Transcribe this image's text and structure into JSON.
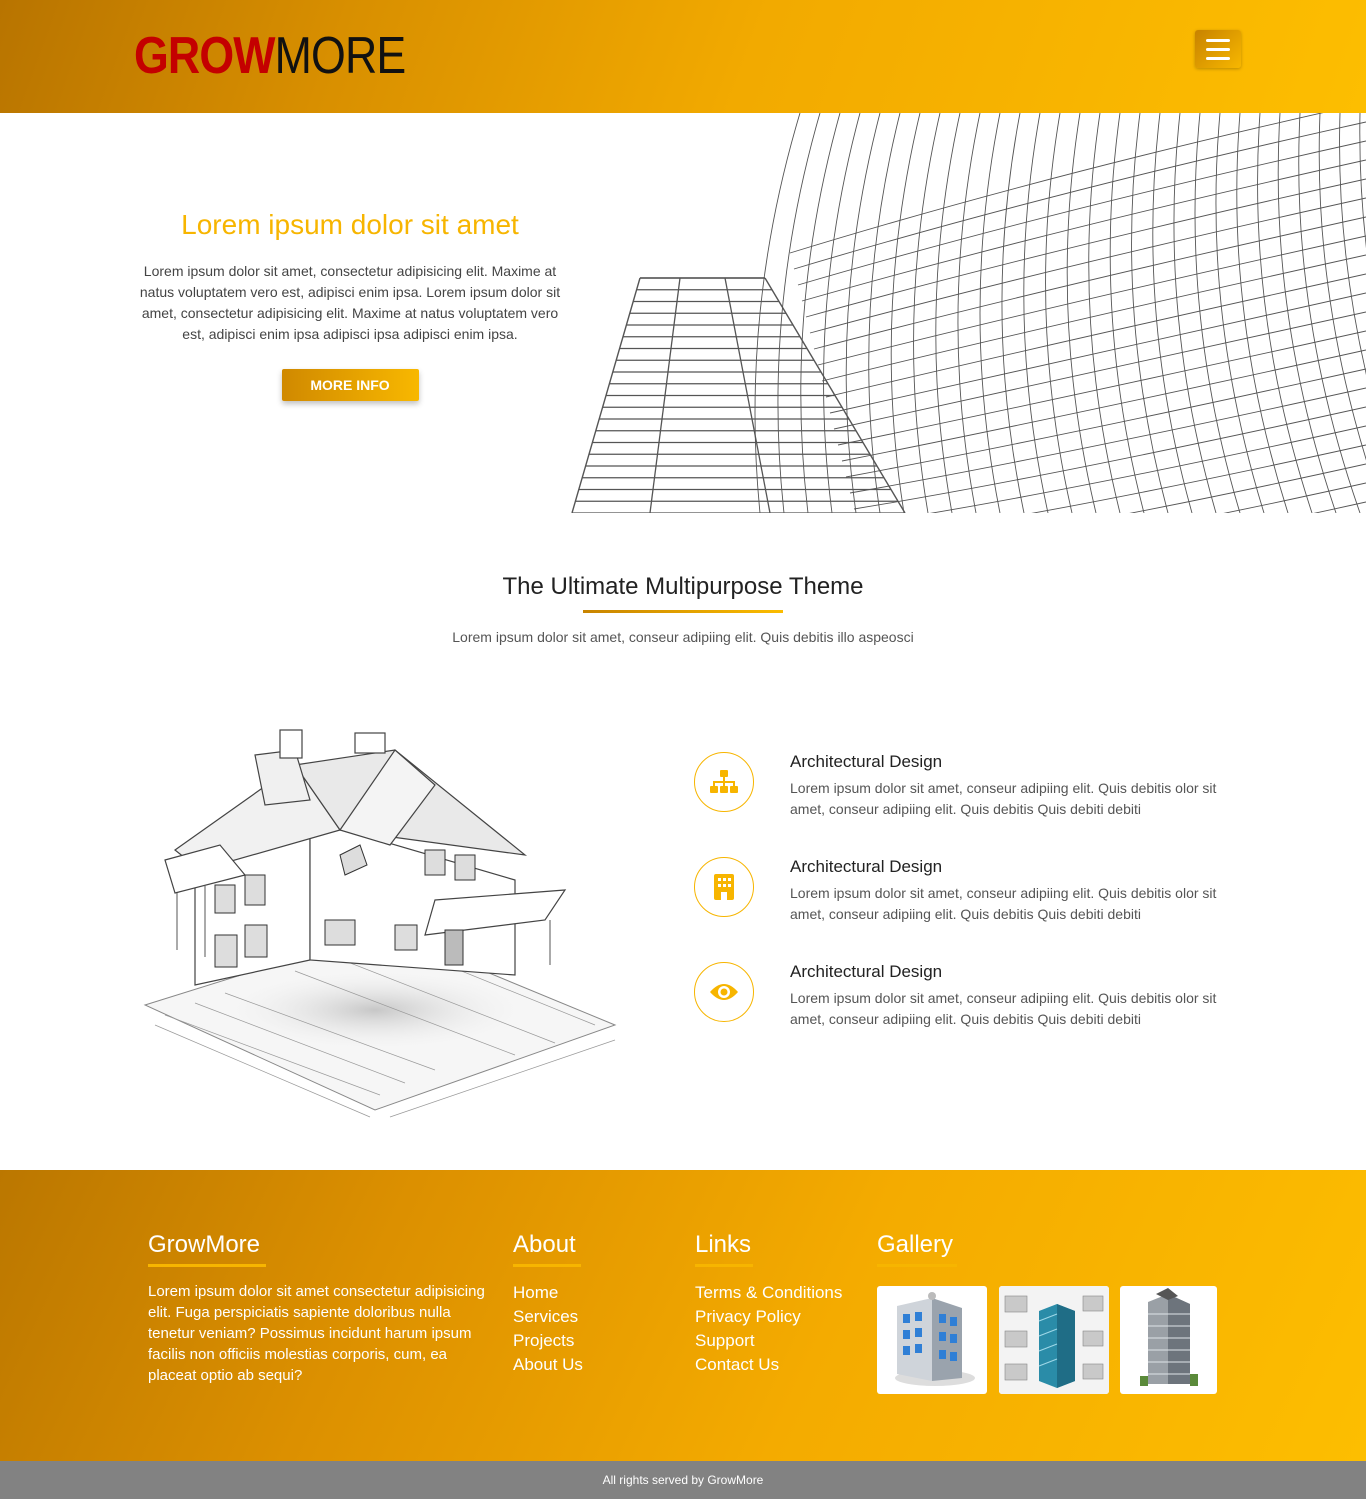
{
  "header": {
    "logo_part1": "GROW",
    "logo_part2": "MORE",
    "menu_icon": "hamburger-menu-icon"
  },
  "hero": {
    "title": "Lorem ipsum dolor sit amet",
    "description": "Lorem ipsum dolor sit amet, consectetur adipisicing elit. Maxime at natus voluptatem vero est, adipisci enim ipsa. Lorem ipsum dolor sit amet, consectetur adipisicing elit. Maxime at natus voluptatem vero est, adipisci enim ipsa adipisci ipsa adipisci enim ipsa.",
    "button_label": "MORE INFO"
  },
  "intro": {
    "title": "The Ultimate Multipurpose Theme",
    "subtitle": "Lorem ipsum dolor sit amet, conseur adipiing elit. Quis debitis illo aspeosci"
  },
  "features": [
    {
      "icon": "sitemap-icon",
      "title": "Architectural Design",
      "description": "Lorem ipsum dolor sit amet, conseur adipiing elit. Quis debitis olor sit amet, conseur adipiing elit. Quis debitis Quis debiti debiti"
    },
    {
      "icon": "building-icon",
      "title": "Architectural Design",
      "description": "Lorem ipsum dolor sit amet, conseur adipiing elit. Quis debitis olor sit amet, conseur adipiing elit. Quis debitis Quis debiti debiti"
    },
    {
      "icon": "eye-icon",
      "title": "Architectural Design",
      "description": "Lorem ipsum dolor sit amet, conseur adipiing elit. Quis debitis olor sit amet, conseur adipiing elit. Quis debitis Quis debiti debiti"
    }
  ],
  "footer": {
    "brand": {
      "title": "GrowMore",
      "text": "Lorem ipsum dolor sit amet consectetur adipisicing elit. Fuga perspiciatis sapiente doloribus nulla tenetur veniam? Possimus incidunt harum ipsum facilis non officiis molestias corporis, cum, ea placeat optio ab sequi?"
    },
    "about": {
      "title": "About",
      "items": [
        "Home",
        "Services",
        "Projects",
        "About Us"
      ]
    },
    "links": {
      "title": "Links",
      "items": [
        "Terms & Conditions",
        "Privacy Policy",
        "Support",
        "Contact Us"
      ]
    },
    "gallery": {
      "title": "Gallery"
    },
    "copyright": "All rights served by GrowMore"
  },
  "colors": {
    "accent": "#f7b500",
    "logo_red": "#c40000",
    "footer_bar": "#828282"
  }
}
